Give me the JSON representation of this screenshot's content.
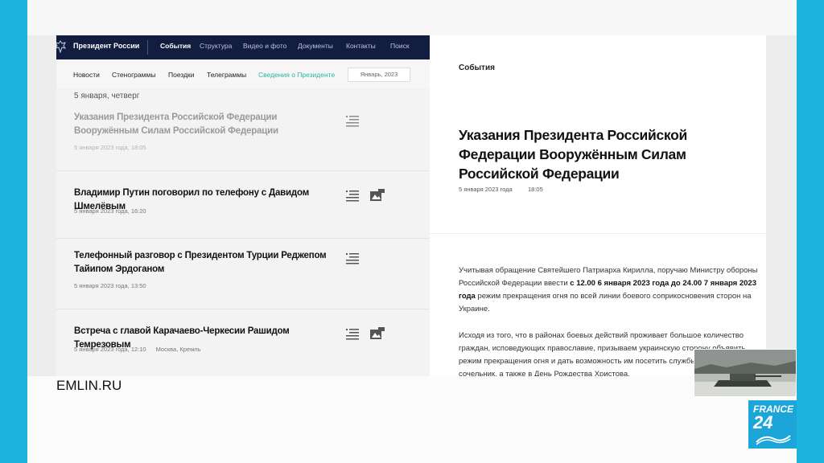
{
  "site": {
    "title": "Президент России",
    "nav": [
      "События",
      "Структура",
      "Видео и фото",
      "Документы",
      "Контакты",
      "Поиск"
    ],
    "subnav": [
      "Новости",
      "Стенограммы",
      "Поездки",
      "Телеграммы",
      "Сведения о Президенте"
    ],
    "date_select": "Январь, 2023",
    "day_heading": "5 января, четверг",
    "news": [
      {
        "title": "Указания Президента Российской Федерации Вооружённым Силам Российской Федерации",
        "meta": "5 января 2023 года, 18:05",
        "place": "",
        "icons": [
          "text-icon"
        ]
      },
      {
        "title": "Владимир Путин поговорил по телефону с Давидом Шмелёвым",
        "meta": "5 января 2023 года, 16:20",
        "place": "",
        "icons": [
          "text-icon",
          "photo-icon"
        ]
      },
      {
        "title": "Телефонный разговор с Президентом Турции Реджепом Тайипом Эрдоганом",
        "meta": "5 января 2023 года, 13:50",
        "place": "",
        "icons": [
          "text-icon"
        ]
      },
      {
        "title": "Встреча с главой Карачаево-Черкесии Рашидом Темрезовым",
        "meta": "5 января 2023 года, 12:10",
        "place": "Москва, Кремль",
        "icons": [
          "text-icon",
          "photo-icon"
        ]
      }
    ]
  },
  "article": {
    "section": "События",
    "title": "Указания Президента Российской Федерации Вооружённым Силам Российской Федерации",
    "date": "5 января 2023 года",
    "time": "18:05",
    "p1_a": "Учитывая обращение Святейшего Патриарха Кирилла, поручаю Министру обороны Российской Федерации ввести ",
    "p1_b": "с 12.00 6 января 2023 года до 24.00 7 января 2023 года",
    "p1_c": " режим прекращения огня по всей линии боевого соприкосновения сторон на Украине.",
    "p2": "Исходя из того, что в районах боевых действий проживает большое количество граждан, исповедующих православие, призываем украинскую сторону объявить режим прекращения огня и дать возможность им посетить службы в Рождественский сочельник, а также в День Рождества Христова."
  },
  "overlay": {
    "caption": "EMLIN.RU",
    "logo_line1": "FRANCE",
    "logo_line2": "24"
  },
  "colors": {
    "frame": "#1cb3df",
    "navbar": "#131d3f",
    "active_subnav": "#2ab89a",
    "logo": "#1ba5d9"
  }
}
